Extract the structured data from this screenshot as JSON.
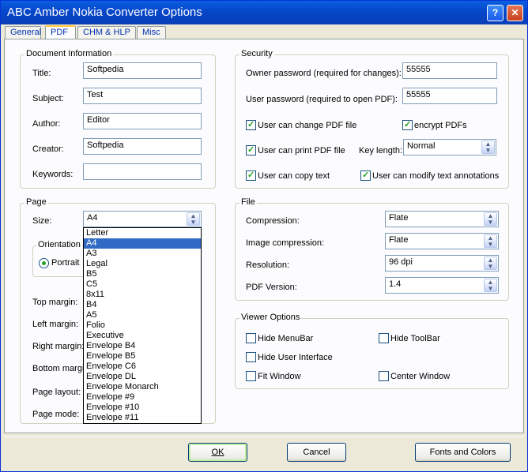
{
  "window": {
    "title": "ABC Amber Nokia Converter Options"
  },
  "tabs": [
    "General",
    "PDF",
    "CHM & HLP",
    "Misc"
  ],
  "docinfo": {
    "legend": "Document Information",
    "title_label": "Title:",
    "title_value": "Softpedia",
    "subject_label": "Subject:",
    "subject_value": "Test",
    "author_label": "Author:",
    "author_value": "Editor",
    "creator_label": "Creator:",
    "creator_value": "Softpedia",
    "keywords_label": "Keywords:",
    "keywords_value": ""
  },
  "security": {
    "legend": "Security",
    "owner_label": "Owner password (required for changes):",
    "owner_value": "55555",
    "user_label": "User password (required to open PDF):",
    "user_value": "55555",
    "change_pdf": "User can change PDF file",
    "encrypt": "encrypt PDFs",
    "print_pdf": "User can print PDF file",
    "keylen_label": "Key length:",
    "keylen_value": "Normal",
    "copy_text": "User can copy text",
    "modify_annot": "User can modify text annotations"
  },
  "page": {
    "legend": "Page",
    "size_label": "Size:",
    "size_value": "A4",
    "orientation_legend": "Orientation",
    "portrait_label": "Portrait",
    "top_margin": "Top margin:",
    "left_margin": "Left margin:",
    "right_margin": "Right margin:",
    "bottom_margin": "Bottom margin",
    "page_layout": "Page layout:",
    "page_mode": "Page mode:"
  },
  "size_options": [
    "Letter",
    "A4",
    "A3",
    "Legal",
    "B5",
    "C5",
    "8x11",
    "B4",
    "A5",
    "Folio",
    "Executive",
    "Envelope B4",
    "Envelope B5",
    "Envelope C6",
    "Envelope DL",
    "Envelope Monarch",
    "Envelope #9",
    "Envelope #10",
    "Envelope #11"
  ],
  "file": {
    "legend": "File",
    "compression_label": "Compression:",
    "compression_value": "Flate",
    "image_comp_label": "Image compression:",
    "image_comp_value": "Flate",
    "resolution_label": "Resolution:",
    "resolution_value": "96 dpi",
    "pdf_version_label": "PDF Version:",
    "pdf_version_value": "1.4"
  },
  "viewer": {
    "legend": "Viewer Options",
    "hide_menubar": "Hide MenuBar",
    "hide_toolbar": "Hide ToolBar",
    "hide_ui": "Hide User Interface",
    "fit_window": "Fit Window",
    "center_window": "Center Window"
  },
  "buttons": {
    "ok": "OK",
    "cancel": "Cancel",
    "fonts": "Fonts and Colors"
  },
  "colors": {
    "titlebar": "#0646c9",
    "selection": "#316ac5",
    "check": "#21a121"
  }
}
